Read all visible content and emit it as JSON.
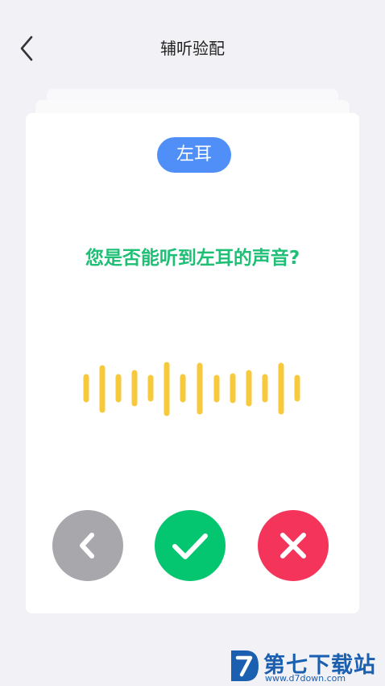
{
  "header": {
    "title": "辅听验配",
    "back_icon": "chevron-left-icon"
  },
  "card": {
    "ear_label": "左耳",
    "question": "您是否能听到左耳的声音?",
    "wave_icon": "sound-wave-icon"
  },
  "controls": {
    "previous_icon": "chevron-left-icon",
    "confirm_icon": "check-icon",
    "deny_icon": "close-icon"
  },
  "watermark": {
    "name": "第七下载站",
    "url": "www.d7down.com"
  },
  "colors": {
    "accent_blue": "#4f8ff7",
    "question_green": "#1fbf76",
    "wave_yellow": "#f7c93d",
    "previous_gray": "#a8a8ac",
    "confirm_green": "#05c670",
    "deny_red": "#f5345c",
    "watermark_blue": "#1b5fb0"
  }
}
